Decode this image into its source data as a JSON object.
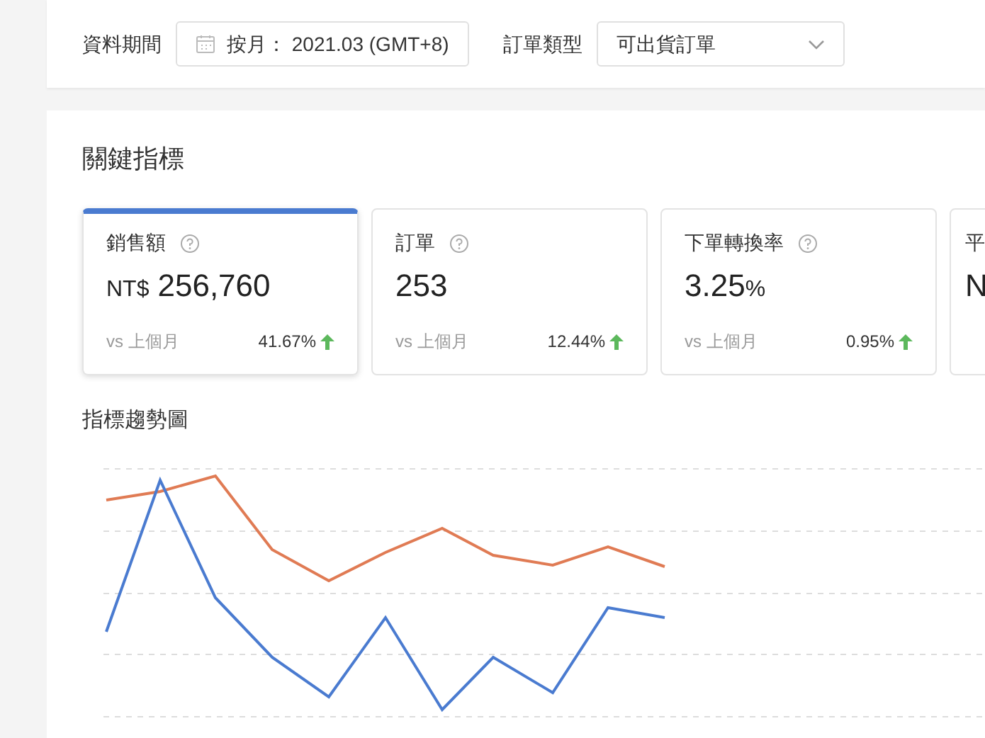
{
  "filters": [
    {
      "label": "資料期間",
      "kind": "date",
      "value": "按月： 2021.03 (GMT+8)"
    },
    {
      "label": "訂單類型",
      "kind": "select",
      "value": "可出貨訂單"
    }
  ],
  "section_title": "關鍵指標",
  "metrics": [
    {
      "title": "銷售額",
      "prefix": "NT$",
      "value": "256,760",
      "compare_label": "vs 上個月",
      "change": "41.67%",
      "rising": true,
      "selected": true
    },
    {
      "title": "訂單",
      "value": "253",
      "compare_label": "vs 上個月",
      "change": "12.44%",
      "rising": true,
      "selected": false
    },
    {
      "title": "下單轉換率",
      "value": "3.25",
      "suffix": "%",
      "compare_label": "vs 上個月",
      "change": "0.95%",
      "rising": true,
      "selected": false
    },
    {
      "title": "平",
      "value": "N",
      "selected": false
    }
  ],
  "chart": {
    "title": "指標趨勢圖"
  }
}
